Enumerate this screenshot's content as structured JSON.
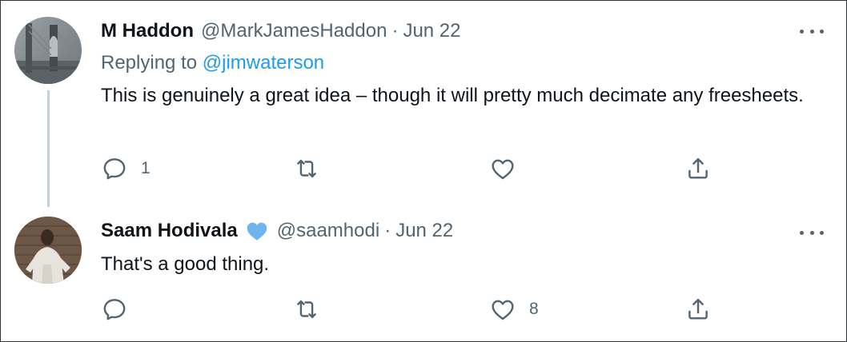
{
  "tweets": [
    {
      "author_name": "M Haddon",
      "handle": "@MarkJamesHaddon",
      "separator": "·",
      "date": "Jun 22",
      "replying_prefix": "Replying to ",
      "replying_to": "@jimwaterson",
      "text": "This is genuinely a great idea – though it will pretty much decimate any freesheets.",
      "reply_count": "1",
      "retweet_count": "",
      "like_count": "",
      "verified": false
    },
    {
      "author_name": "Saam Hodivala",
      "handle": "@saamhodi",
      "separator": "·",
      "date": "Jun 22",
      "text": "That's a good thing.",
      "reply_count": "",
      "retweet_count": "",
      "like_count": "8",
      "verified": true
    }
  ],
  "icons": {
    "reply": "reply-icon",
    "retweet": "retweet-icon",
    "like": "heart-icon",
    "share": "share-icon",
    "more": "more-options-icon",
    "verified": "verified-badge-icon"
  },
  "colors": {
    "text_primary": "#0f1419",
    "text_secondary": "#536471",
    "link": "#1d9bf0",
    "verified_badge": "#70b4ef",
    "thread_line": "#c4cfd6"
  }
}
